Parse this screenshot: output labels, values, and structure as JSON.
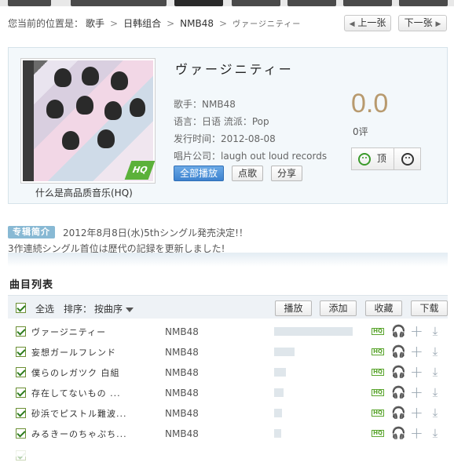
{
  "breadcrumb": {
    "prefix": "您当前的位置是：",
    "items": [
      "歌手",
      "日韩组合",
      "NMB48"
    ],
    "current": "ヴァージニティー"
  },
  "pager": {
    "prev": "上一张",
    "next": "下一张"
  },
  "album": {
    "title": "ヴァージニティー",
    "hq_badge": "HQ",
    "cover_caption": "什么是高品质音乐(HQ)",
    "singer_label": "歌手：",
    "singer": "NMB48",
    "language_label": "语言：",
    "language": "日语",
    "genre_label": "流派：",
    "genre": "Pop",
    "release_label": "发行时间：",
    "release": "2012-08-08",
    "label_label": "唱片公司：",
    "label": "laugh out loud records",
    "btn_play_all": "全部播放",
    "btn_request": "点歌",
    "btn_share": "分享",
    "score": "0.0",
    "score_count": "0评",
    "vote_up": "顶"
  },
  "intro": {
    "label": "专辑简介",
    "line1": "2012年8月8日(水)5thシングル発売決定!！",
    "line2": "3作連続シングル首位は歴代の記録を更新しました!"
  },
  "tracklist": {
    "title": "曲目列表",
    "select_all": "全选",
    "sort_label": "排序：",
    "sort_value": "按曲序",
    "btn_play": "播放",
    "btn_add": "添加",
    "btn_fav": "收藏",
    "btn_download": "下载",
    "hq": "HQ",
    "rows": [
      {
        "title": "ヴァージニティー",
        "artist": "NMB48",
        "popularity": 1.0
      },
      {
        "title": "妄想ガールフレンド",
        "artist": "NMB48",
        "popularity": 0.26
      },
      {
        "title": "僕らのレガツク 白組",
        "artist": "NMB48",
        "popularity": 0.15
      },
      {
        "title": "存在してないもの ...",
        "artist": "NMB48",
        "popularity": 0.12
      },
      {
        "title": "砂浜でピストル難波...",
        "artist": "NMB48",
        "popularity": 0.1
      },
      {
        "title": "みるきーのちゃぷち...",
        "artist": "NMB48",
        "popularity": 0.09
      }
    ]
  }
}
